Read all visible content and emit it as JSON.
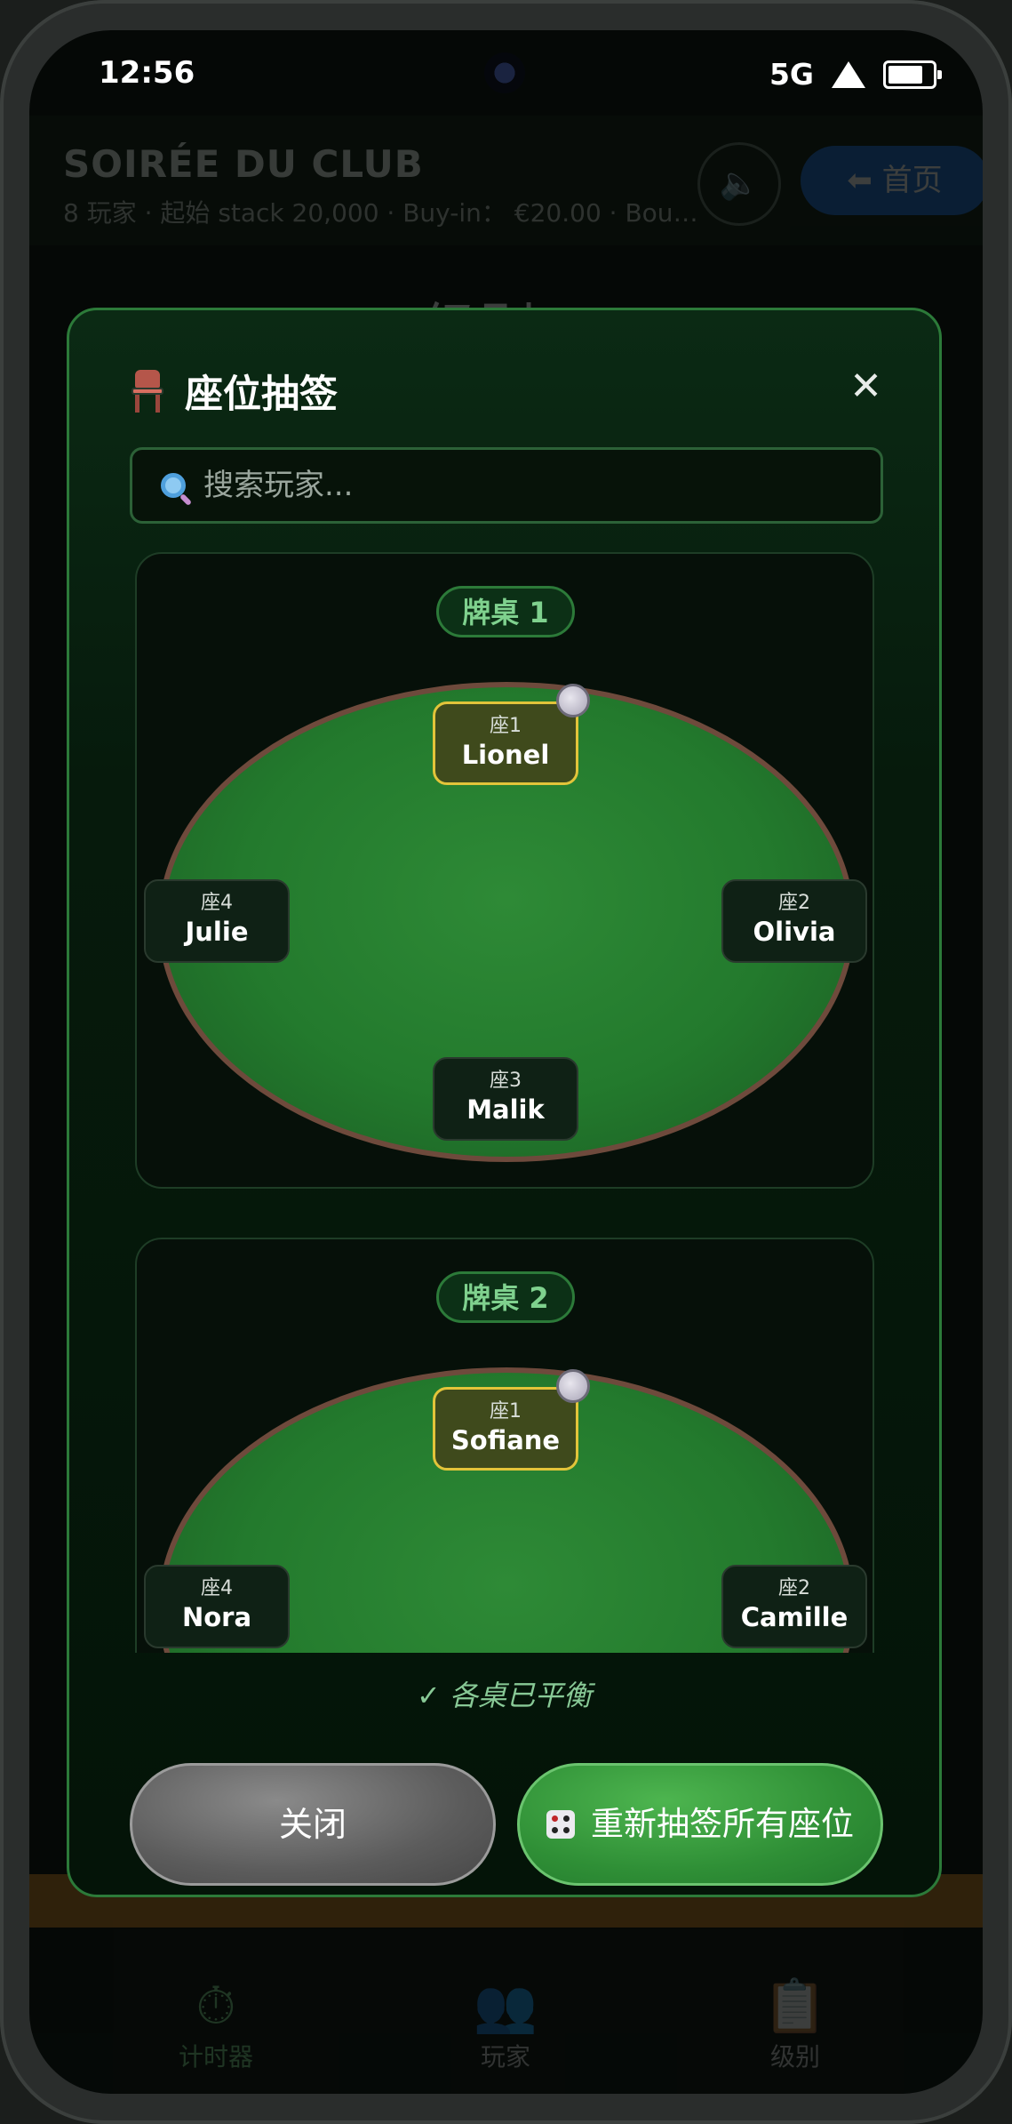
{
  "status_bar": {
    "time": "12:56",
    "network": "5G"
  },
  "background_app": {
    "title": "SOIRÉE DU CLUB",
    "subtitle": "8 玩家 · 起始 stack 20,000 · Buy-in： €20.00 · Bounty...",
    "home_button": "⬅ 首页",
    "level_heading": "级别 1",
    "tabs": [
      {
        "icon": "⏱",
        "label": "计时器"
      },
      {
        "icon": "👥",
        "label": "玩家"
      },
      {
        "icon": "📋",
        "label": "级别"
      }
    ]
  },
  "modal": {
    "title": "座位抽签",
    "search_placeholder": "搜索玩家...",
    "tables": [
      {
        "name": "牌桌 1",
        "seats": [
          {
            "label": "座1",
            "player": "Lionel",
            "dealer": true
          },
          {
            "label": "座2",
            "player": "Olivia"
          },
          {
            "label": "座3",
            "player": "Malik"
          },
          {
            "label": "座4",
            "player": "Julie"
          }
        ]
      },
      {
        "name": "牌桌 2",
        "seats": [
          {
            "label": "座1",
            "player": "Sofiane",
            "dealer": true
          },
          {
            "label": "座2",
            "player": "Camille"
          },
          {
            "label": "座4",
            "player": "Nora"
          }
        ]
      }
    ],
    "balance_status": "✓ 各桌已平衡",
    "close_button": "关闭",
    "redraw_button": "重新抽签所有座位"
  },
  "colors": {
    "accent": "#2c7a39",
    "felt": "#237a2d",
    "dealer_highlight": "#e2c43a"
  }
}
